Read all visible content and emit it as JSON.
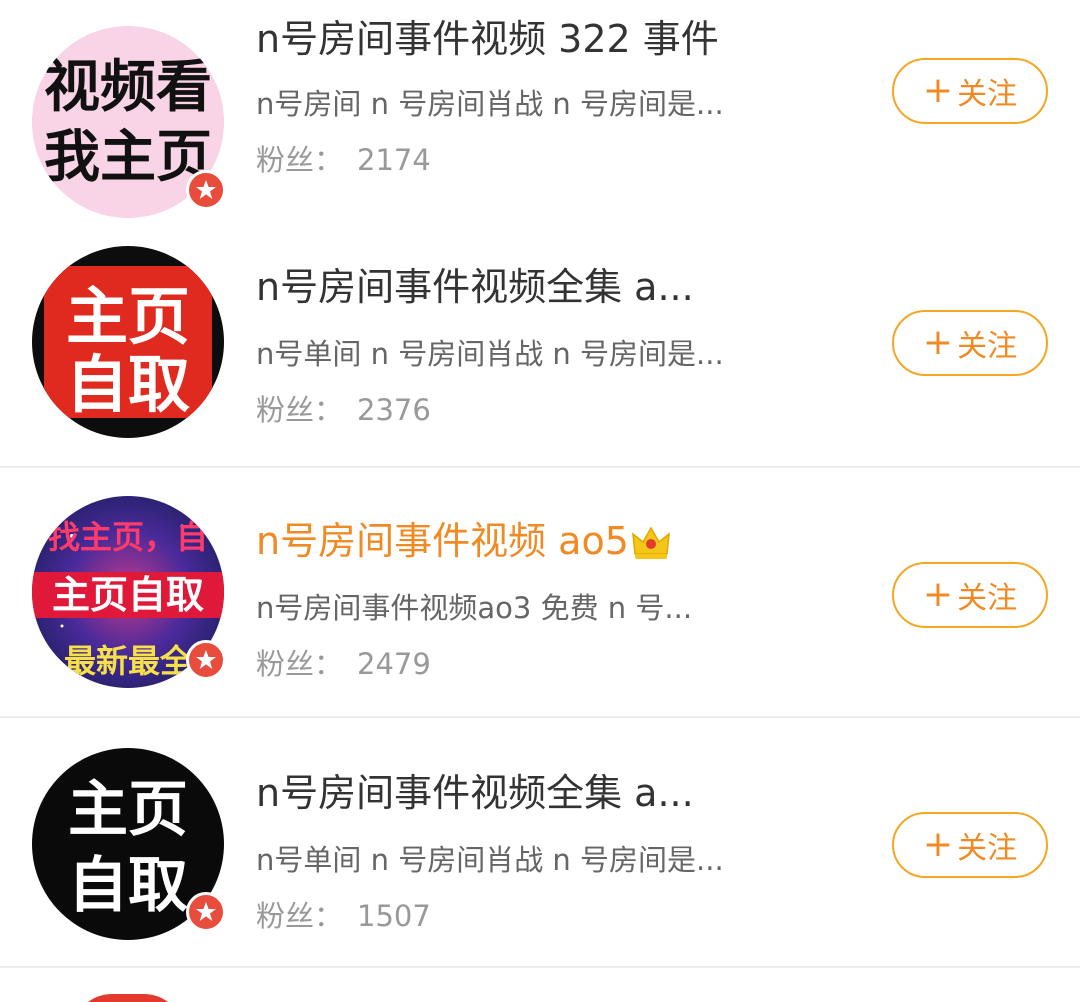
{
  "colors": {
    "accent": "#f08a24",
    "follow_border": "#f5a623",
    "verified_badge": "#e74c3c",
    "name_text": "#333333",
    "desc_text": "#666666",
    "fans_text": "#999999"
  },
  "follow_label": "关注",
  "follow_plus": "+",
  "fans_label": "粉丝：",
  "users": [
    {
      "name": "n号房间事件视频 322 事件",
      "description": "n号房间 n 号房间肖战 n 号房间是...",
      "fans": "2174",
      "avatar_text": [
        "视频看",
        "我主页"
      ],
      "verified": true,
      "vip": false
    },
    {
      "name": "n号房间事件视频全集 a...",
      "description": "n号单间 n 号房间肖战 n 号房间是...",
      "fans": "2376",
      "avatar_text": [
        "主页",
        "自取"
      ],
      "verified": false,
      "vip": false
    },
    {
      "name": "n号房间事件视频 ao5",
      "description": "n号房间事件视频ao3 免费 n 号...",
      "fans": "2479",
      "avatar_text": [
        "找主页，自",
        "主页自取",
        "最新最全"
      ],
      "verified": true,
      "vip": true,
      "name_icon": "crown-icon"
    },
    {
      "name": "n号房间事件视频全集 a...",
      "description": "n号单间 n 号房间肖战 n 号房间是...",
      "fans": "1507",
      "avatar_text": [
        "主页",
        "自取"
      ],
      "verified": true,
      "vip": false
    }
  ]
}
